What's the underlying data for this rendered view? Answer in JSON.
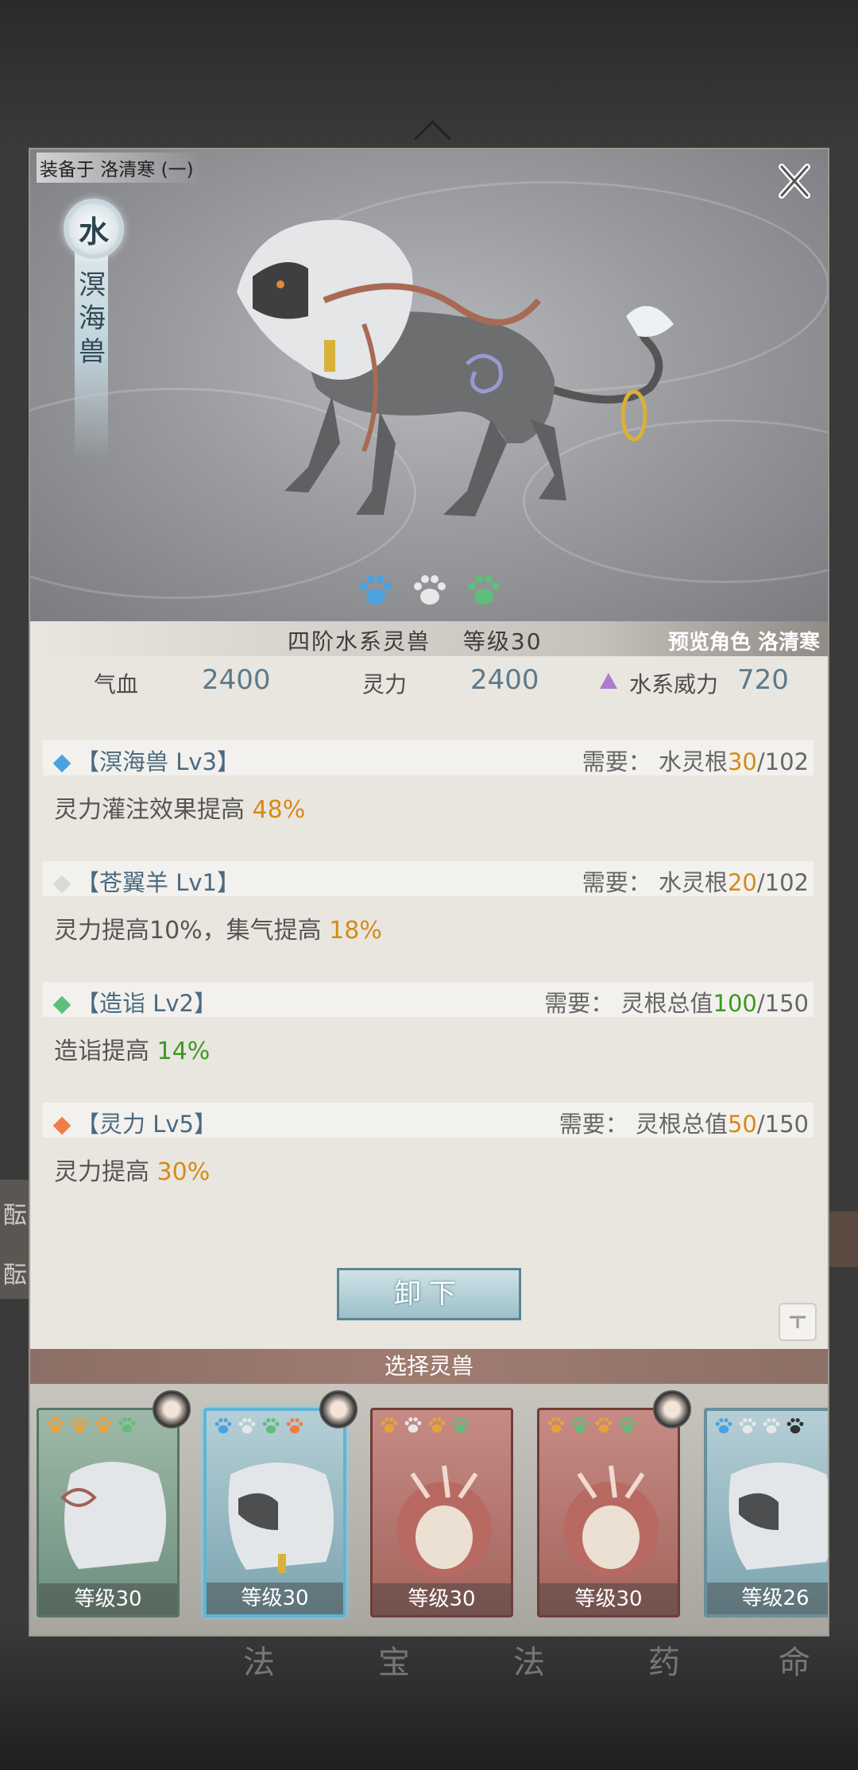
{
  "window": {
    "equip_label": "装备于 洛清寒 (一)"
  },
  "beast": {
    "element": "水",
    "name_chars": [
      "溟",
      "海",
      "兽"
    ],
    "paws": [
      {
        "icon": "paw-icon",
        "color": "#4aa3e0"
      },
      {
        "icon": "paw-icon",
        "color": "#e8e8e8"
      },
      {
        "icon": "paw-icon",
        "color": "#5fbf7a"
      }
    ]
  },
  "header": {
    "title": "四阶水系灵兽　 等级30",
    "preview": "预览角色 洛清寒"
  },
  "stats": {
    "hp_label": "气血",
    "hp_value": "2400",
    "mp_label": "灵力",
    "mp_value": "2400",
    "power_label": "水系威力",
    "power_value": "720",
    "power_color": "#b07ad0"
  },
  "skills": [
    {
      "name": "【溟海兽 Lv3】",
      "req_prefix": "需要：  水灵根",
      "req_have": "30",
      "req_total": "/102",
      "have_color": "orange",
      "desc_prefix": "灵力灌注效果提高 ",
      "desc_value": "48%",
      "desc_color": "orange",
      "diamond": "#4aa3e0"
    },
    {
      "name": "【苍翼羊 Lv1】",
      "req_prefix": "需要：  水灵根",
      "req_have": "20",
      "req_total": "/102",
      "have_color": "orange",
      "desc_prefix": "灵力提高10%，集气提高 ",
      "desc_value": "18%",
      "desc_color": "orange",
      "diamond": "#d9d9d9"
    },
    {
      "name": "【造诣 Lv2】",
      "req_prefix": "需要：  灵根总值",
      "req_have": "100",
      "req_total": "/150",
      "have_color": "green",
      "desc_prefix": "造诣提高 ",
      "desc_value": "14%",
      "desc_color": "green",
      "diamond": "#5fbf7a"
    },
    {
      "name": "【灵力 Lv5】",
      "req_prefix": "需要：  灵根总值",
      "req_have": "50",
      "req_total": "/150",
      "have_color": "orange",
      "desc_prefix": "灵力提高 ",
      "desc_value": "30%",
      "desc_color": "orange",
      "diamond": "#ef7d4a"
    }
  ],
  "actions": {
    "unequip": "卸下"
  },
  "selection": {
    "title": "选择灵兽",
    "cards": [
      {
        "level": "等级30",
        "style": "green",
        "paws": [
          "#e8a23a",
          "#e8a23a",
          "#e8a23a",
          "#5fbf7a"
        ],
        "has_avatar": true
      },
      {
        "level": "等级30",
        "style": "blue",
        "paws": [
          "#4aa3e0",
          "#e8e8e8",
          "#5fbf7a",
          "#ef7d4a"
        ],
        "has_avatar": true
      },
      {
        "level": "等级30",
        "style": "red",
        "paws": [
          "#e8a23a",
          "#e8e8e8",
          "#e8a23a",
          "#5fbf7a"
        ],
        "has_avatar": false
      },
      {
        "level": "等级30",
        "style": "red",
        "paws": [
          "#e8a23a",
          "#5fbf7a",
          "#e8a23a",
          "#5fbf7a"
        ],
        "has_avatar": true
      },
      {
        "level": "等级26",
        "style": "blue2",
        "paws": [
          "#4aa3e0",
          "#e8e8e8",
          "#e8e8e8",
          "#333333"
        ],
        "has_avatar": false
      }
    ]
  },
  "background_nav": [
    "法",
    "宝",
    "法",
    "药",
    "命"
  ],
  "side_chars": [
    "酝",
    "酝"
  ]
}
